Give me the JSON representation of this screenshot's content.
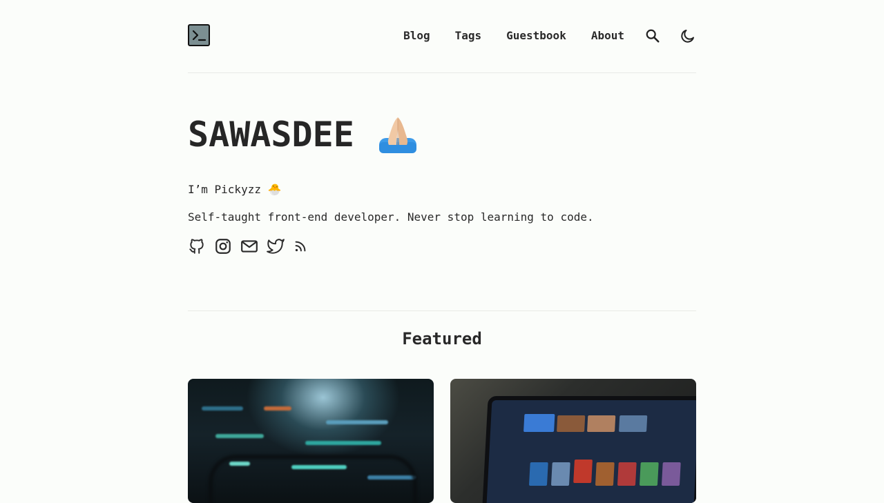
{
  "nav": {
    "links": [
      "Blog",
      "Tags",
      "Guestbook",
      "About"
    ],
    "search_icon": "search-icon",
    "theme_icon": "moon-icon"
  },
  "hero": {
    "title": "SAWASDEE",
    "title_emoji": "folded-hands",
    "greeting": "I’m Pickyzz 🐣",
    "tagline": "Self-taught front-end developer. Never stop learning to code."
  },
  "social": [
    "github-icon",
    "instagram-icon",
    "mail-icon",
    "twitter-icon",
    "rss-icon"
  ],
  "featured": {
    "heading": "Featured",
    "cards": [
      {
        "image": "code-on-monitor"
      },
      {
        "image": "game-library-on-laptop"
      }
    ]
  },
  "colors": {
    "background": "#fbfdfa",
    "text": "#282828",
    "divider": "#e8eae6",
    "logo_fill": "#7c8f92"
  }
}
